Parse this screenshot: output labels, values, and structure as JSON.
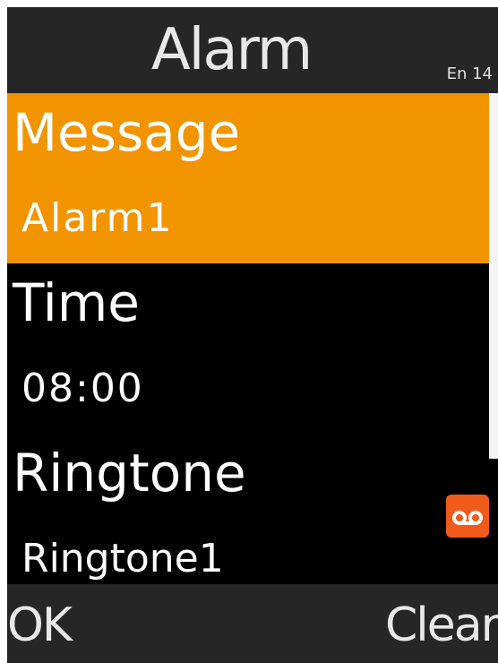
{
  "header": {
    "title": "Alarm",
    "status": "En 14"
  },
  "fields": [
    {
      "label": "Message",
      "value": "Alarm1",
      "selected": true
    },
    {
      "label": "Time",
      "value": "08:00",
      "selected": false
    },
    {
      "label": "Ringtone",
      "value": "Ringtone1",
      "selected": false
    }
  ],
  "indicators": {
    "voicemail_icon": "voicemail-icon"
  },
  "softkeys": {
    "left": "OK",
    "right": "Clear"
  },
  "colors": {
    "selection": "#f29400",
    "bar": "#262626",
    "background": "#000000",
    "voicemail": "#f05a1a"
  }
}
